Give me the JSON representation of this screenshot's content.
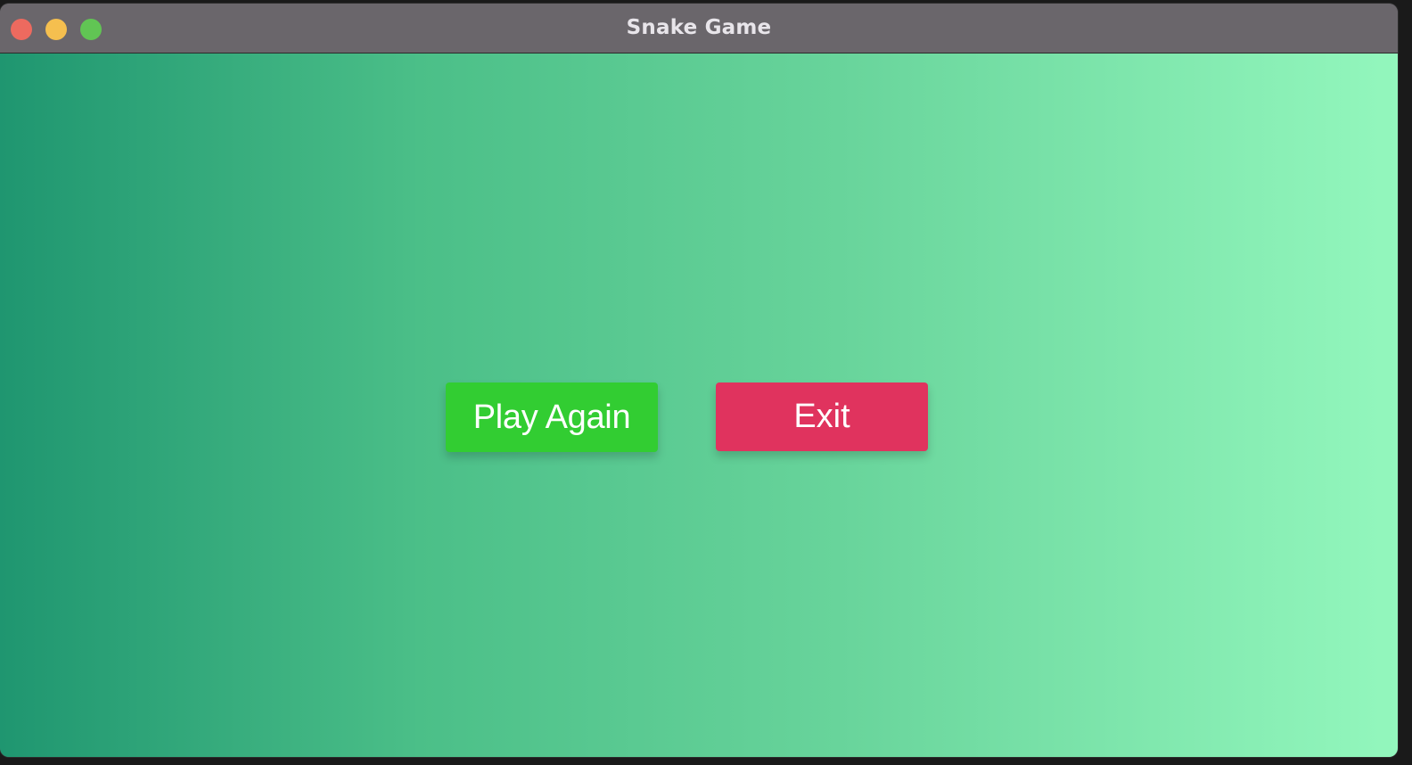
{
  "window": {
    "title": "Snake Game",
    "controls": {
      "close": "close-button",
      "minimize": "minimize-button",
      "zoom": "zoom-button"
    }
  },
  "menu": {
    "play_again_label": "Play Again",
    "exit_label": "Exit"
  },
  "colors": {
    "play_again": "#32cd32",
    "exit": "#e0335e",
    "gradient_start": "#1f9670",
    "gradient_end": "#93f7bd"
  }
}
